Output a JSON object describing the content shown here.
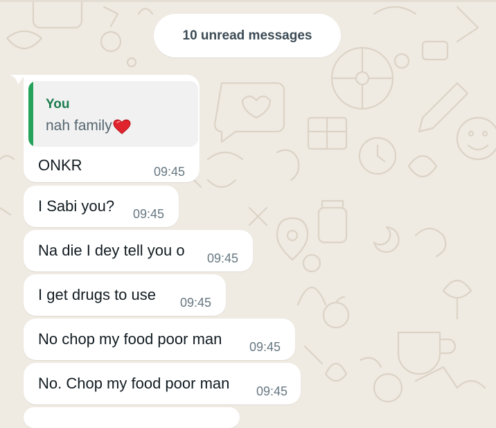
{
  "chat": {
    "unread_banner": "10 unread messages",
    "messages": [
      {
        "reply": {
          "author": "You",
          "text": "nah family",
          "emoji": "❤️"
        },
        "text": "ONKR",
        "time": "09:45"
      },
      {
        "text": "I Sabi you?",
        "time": "09:45"
      },
      {
        "text": "Na die I dey tell you o",
        "time": "09:45"
      },
      {
        "text": "I get drugs to use",
        "time": "09:45"
      },
      {
        "text": "No chop my food poor man",
        "time": "09:45"
      },
      {
        "text": "No. Chop my food poor man",
        "time": "09:45"
      }
    ]
  },
  "icons": {
    "reply_emoji": "red-heart-icon",
    "background": "doodle-wallpaper"
  },
  "colors": {
    "chat_background": "#efeae2",
    "bubble": "#ffffff",
    "quote_bar": "#25a35b",
    "quote_author": "#1b7c4d",
    "time": "#667781"
  }
}
